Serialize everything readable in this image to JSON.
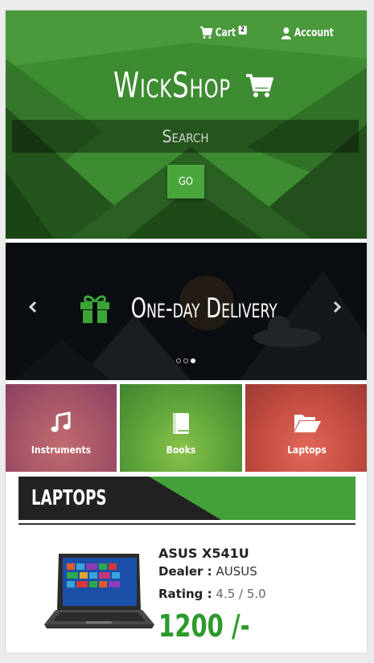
{
  "nav": {
    "cart_label": "Cart",
    "cart_count": "2",
    "account_label": "Account"
  },
  "brand": {
    "name": "WickShop"
  },
  "search": {
    "placeholder": "Search",
    "go_label": "GO"
  },
  "slider": {
    "caption": "One-day Delivery",
    "prev_icon": "chevron-left-icon",
    "next_icon": "chevron-right-icon",
    "dot_count": 3,
    "active_index": 2
  },
  "categories": [
    {
      "label": "Instruments",
      "icon": "music-icon",
      "color": "#b05460"
    },
    {
      "label": "Books",
      "icon": "book-icon",
      "color": "#5ea73b"
    },
    {
      "label": "Laptops",
      "icon": "folder-open-icon",
      "color": "#c04b3e"
    }
  ],
  "section": {
    "title": "LAPTOPS"
  },
  "product": {
    "name": "ASUS X541U",
    "dealer_label": "Dealer :",
    "dealer_value": "AUSUS",
    "rating_label": "Rating :",
    "rating_value": "4.5 / 5.0",
    "price": "1200 /-"
  },
  "colors": {
    "brand_green": "#3f8f32",
    "accent_green": "#43a03a",
    "price_green": "#2d9a2b",
    "dark": "#222222"
  }
}
